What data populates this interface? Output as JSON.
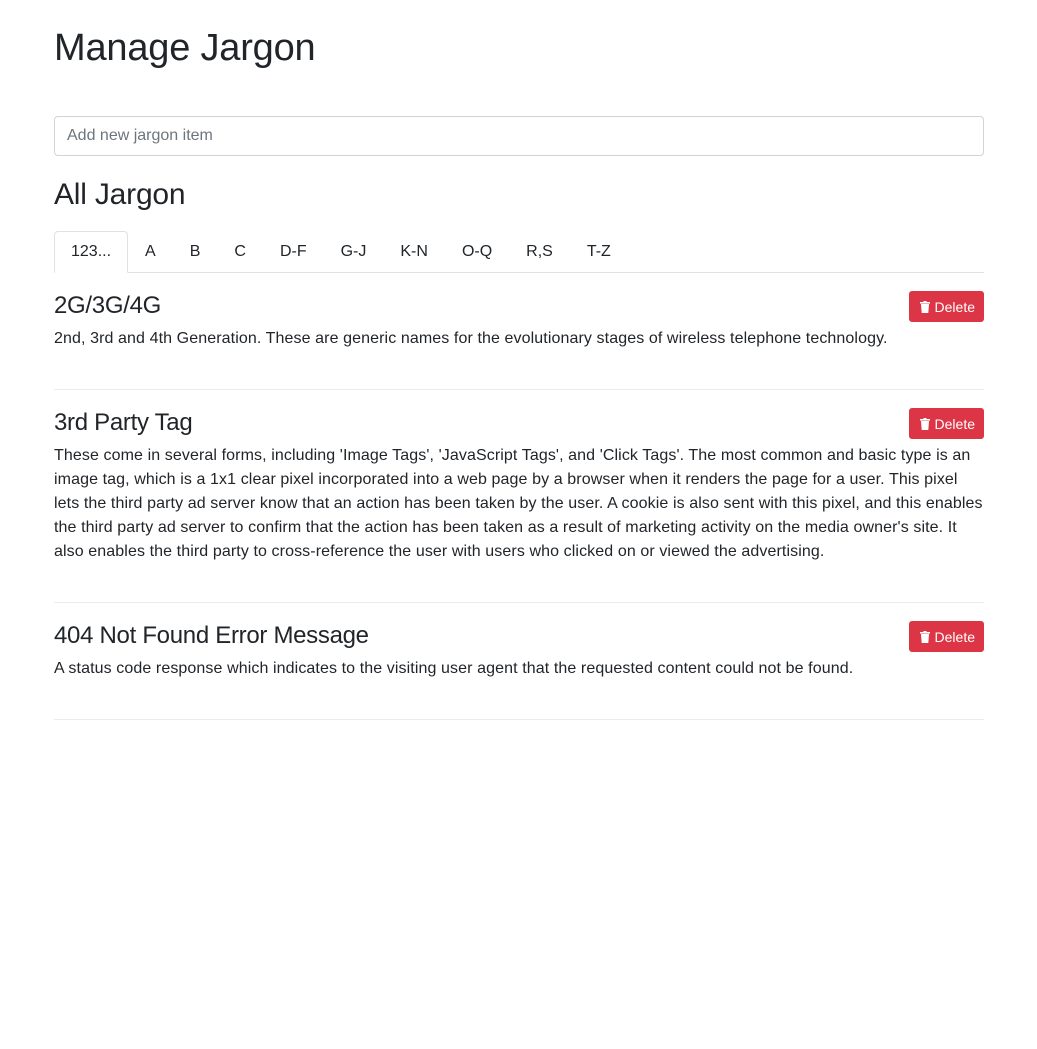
{
  "header": {
    "title": "Manage Jargon"
  },
  "add_input": {
    "placeholder": "Add new jargon item",
    "value": ""
  },
  "section": {
    "title": "All Jargon"
  },
  "tabs": [
    {
      "label": "123...",
      "active": true
    },
    {
      "label": "A",
      "active": false
    },
    {
      "label": "B",
      "active": false
    },
    {
      "label": "C",
      "active": false
    },
    {
      "label": "D-F",
      "active": false
    },
    {
      "label": "G-J",
      "active": false
    },
    {
      "label": "K-N",
      "active": false
    },
    {
      "label": "O-Q",
      "active": false
    },
    {
      "label": "R,S",
      "active": false
    },
    {
      "label": "T-Z",
      "active": false
    }
  ],
  "entries": [
    {
      "term": "2G/3G/4G",
      "definition": "2nd, 3rd and 4th Generation. These are generic names for the evolutionary stages of wireless telephone technology.",
      "delete_label": "Delete"
    },
    {
      "term": "3rd Party Tag",
      "definition": "These come in several forms, including 'Image Tags', 'JavaScript Tags', and 'Click Tags'. The most common and basic type is an image tag, which is a 1x1 clear pixel incorporated into a web page by a browser when it renders the page for a user. This pixel lets the third party ad server know that an action has been taken by the user. A cookie is also sent with this pixel, and this enables the third party ad server to confirm that the action has been taken as a result of marketing activity on the media owner's site. It also enables the third party to cross-reference the user with users who clicked on or viewed the advertising.",
      "delete_label": "Delete"
    },
    {
      "term": "404 Not Found Error Message",
      "definition": "A status code response which indicates to the visiting user agent that the requested content could not be found.",
      "delete_label": "Delete"
    }
  ],
  "colors": {
    "danger": "#dc3545",
    "border": "#dee2e6",
    "text": "#212529"
  },
  "icons": {
    "delete": "trash-icon"
  }
}
